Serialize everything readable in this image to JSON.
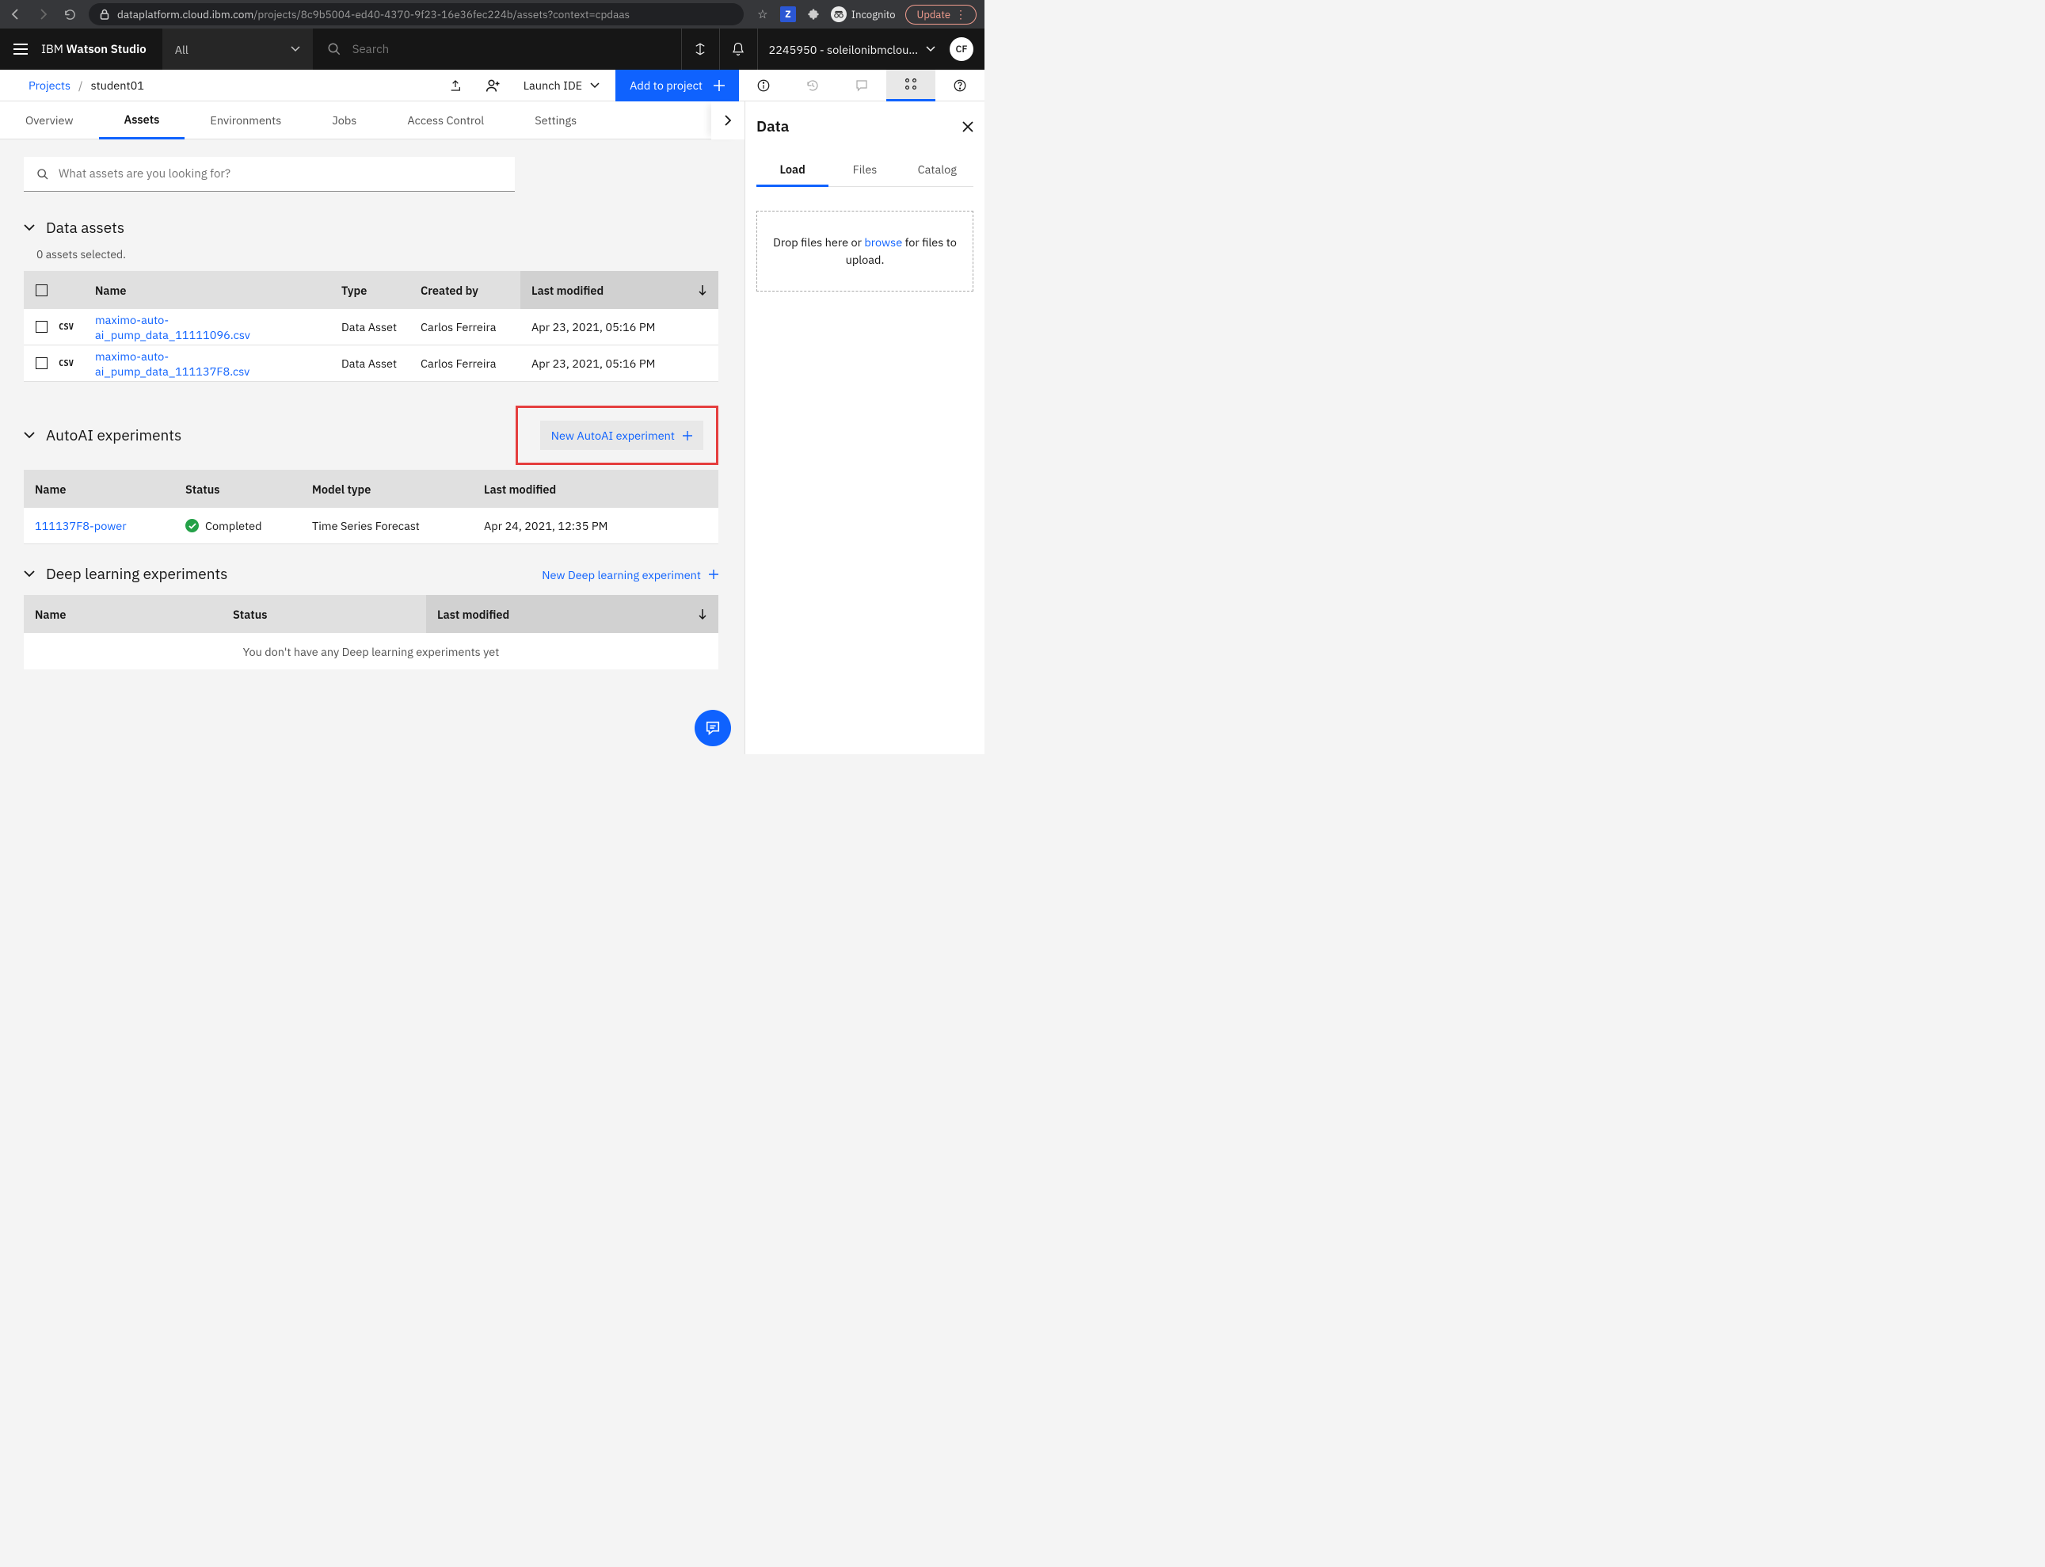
{
  "browser": {
    "url_host": "dataplatform.cloud.ibm.com",
    "url_path": "/projects/8c9b5004-ed40-4370-9f23-16e36fec224b/assets?context=cpdaas",
    "incognito_label": "Incognito",
    "update_label": "Update"
  },
  "header": {
    "brand_prefix": "IBM ",
    "brand_bold": "Watson Studio",
    "scope": "All",
    "search_placeholder": "Search",
    "account": "2245950 - soleilonibmclou…",
    "avatar": "CF"
  },
  "subheader": {
    "crumb_root": "Projects",
    "crumb_current": "student01",
    "launch_ide": "Launch IDE",
    "add_to_project": "Add to project"
  },
  "tabs": [
    "Overview",
    "Assets",
    "Environments",
    "Jobs",
    "Access Control",
    "Settings"
  ],
  "asset_search_placeholder": "What assets are you looking for?",
  "data_assets": {
    "title": "Data assets",
    "selected_note": "0 assets selected.",
    "columns": {
      "name": "Name",
      "type": "Type",
      "created": "Created by",
      "modified": "Last modified"
    },
    "rows": [
      {
        "badge": "CSV",
        "name": "maximo-auto-ai_pump_data_11111096.csv",
        "type": "Data Asset",
        "created": "Carlos Ferreira",
        "modified": "Apr 23, 2021, 05:16 PM"
      },
      {
        "badge": "CSV",
        "name": "maximo-auto-ai_pump_data_111137F8.csv",
        "type": "Data Asset",
        "created": "Carlos Ferreira",
        "modified": "Apr 23, 2021, 05:16 PM"
      }
    ]
  },
  "autoai": {
    "title": "AutoAI experiments",
    "new_btn": "New AutoAI experiment",
    "columns": {
      "name": "Name",
      "status": "Status",
      "model": "Model type",
      "modified": "Last modified"
    },
    "rows": [
      {
        "name": "111137F8-power",
        "status": "Completed",
        "model": "Time Series Forecast",
        "modified": "Apr 24, 2021, 12:35 PM"
      }
    ]
  },
  "dl": {
    "title": "Deep learning experiments",
    "new_btn": "New Deep learning experiment",
    "columns": {
      "name": "Name",
      "status": "Status",
      "modified": "Last modified"
    },
    "empty": "You don't have any Deep learning experiments yet"
  },
  "side": {
    "title": "Data",
    "tabs": [
      "Load",
      "Files",
      "Catalog"
    ],
    "drop_pre": "Drop files here or ",
    "drop_link": "browse",
    "drop_post": " for files to upload."
  }
}
